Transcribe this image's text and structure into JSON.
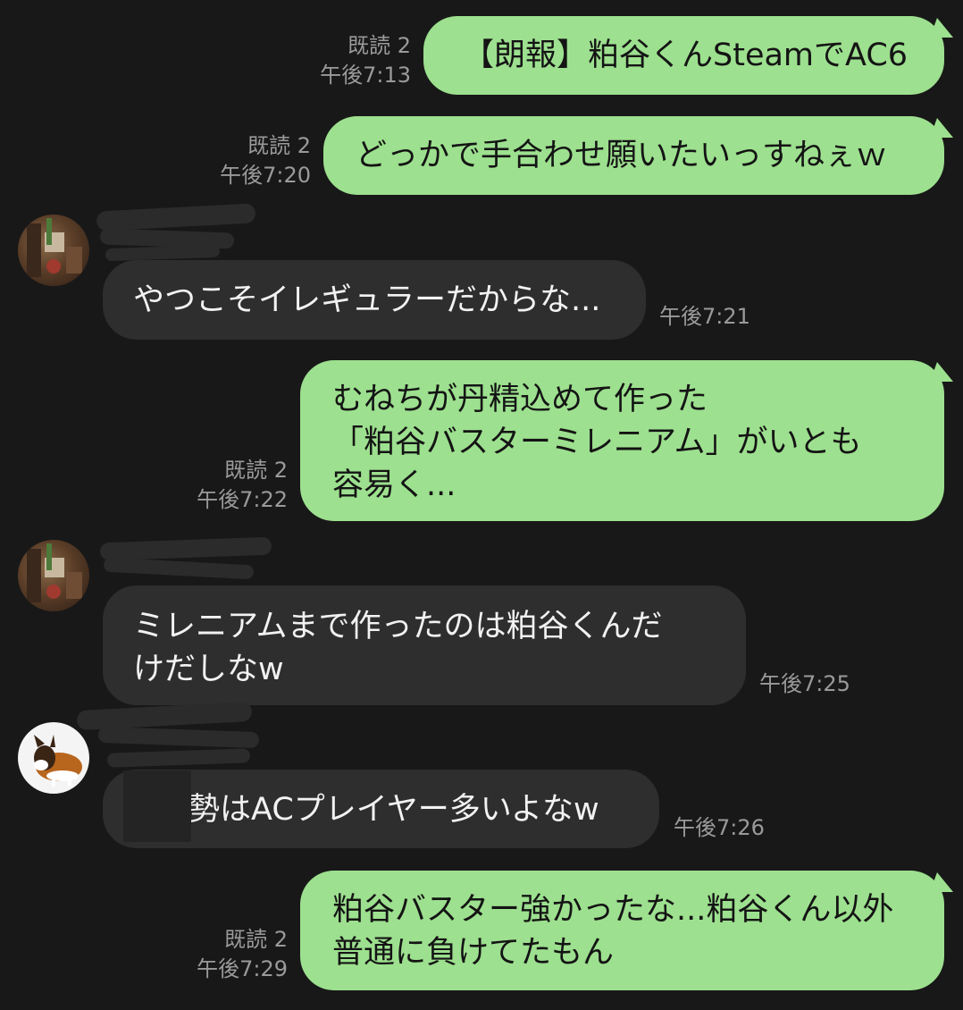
{
  "messages": [
    {
      "side": "out",
      "lines": [
        "【朗報】粕谷くんSteamでAC6"
      ],
      "read": "既読 2",
      "time": "午後7:13"
    },
    {
      "side": "out",
      "lines": [
        "どっかで手合わせ願いたいっすねぇｗ"
      ],
      "read": "既読 2",
      "time": "午後7:20"
    },
    {
      "side": "in",
      "lines": [
        "やつこそイレギュラーだからな..."
      ],
      "time": "午後7:21"
    },
    {
      "side": "out",
      "lines": [
        "むねちが丹精込めて作った",
        "「粕谷バスターミレニアム」がいとも",
        "容易く..."
      ],
      "read": "既読 2",
      "time": "午後7:22"
    },
    {
      "side": "in",
      "lines": [
        "ミレニアムまで作ったのは粕谷くんだ",
        "けだしなw"
      ],
      "time": "午後7:25"
    },
    {
      "side": "in",
      "lines": [
        "勢はACプレイヤー多いよなw"
      ],
      "time": "午後7:26"
    },
    {
      "side": "out",
      "lines": [
        "粕谷バスター強かったな...粕谷くん以外",
        "普通に負けてたもん"
      ],
      "read": "既読 2",
      "time": "午後7:29"
    }
  ],
  "colors": {
    "background": "#181818",
    "outgoing_bubble": "#9de08f",
    "incoming_bubble": "#2e2e2e",
    "meta_text": "#9a9a9a"
  }
}
